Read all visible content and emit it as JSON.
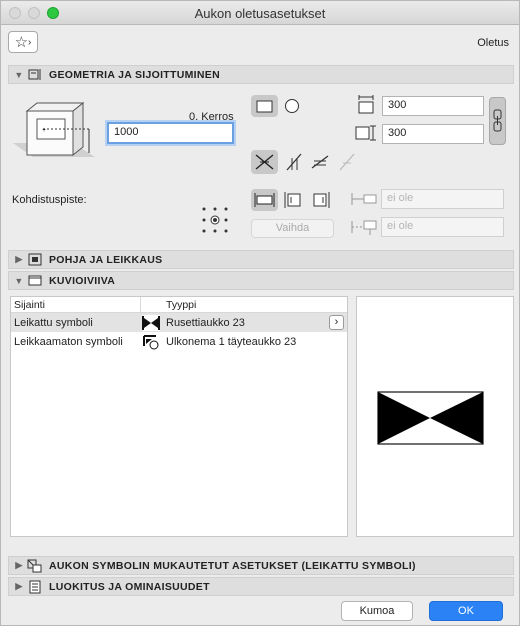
{
  "window": {
    "title": "Aukon oletusasetukset"
  },
  "favorites": {
    "label": "Oletus"
  },
  "sections": {
    "geometry": "GEOMETRIA JA SIJOITTUMINEN",
    "plan": "POHJA JA LEIKKAUS",
    "outline": "KUVIOIVIIVA",
    "custom": "AUKON SYMBOLIN MUKAUTETUT ASETUKSET (LEIKATTU SYMBOLI)",
    "classification": "LUOKITUS JA OMINAISUUDET"
  },
  "geometry": {
    "story_label": "0. Kerros",
    "elevation_value": "1000",
    "width_value": "300",
    "height_value": "300",
    "anchor_label": "Kohdistuspiste:",
    "swap_button": "Vaihda",
    "offset1_placeholder": "ei ole",
    "offset2_placeholder": "ei ole"
  },
  "table": {
    "col_location": "Sijainti",
    "col_type": "Tyyppi",
    "rows": [
      {
        "location": "Leikattu symboli",
        "type": "Rusettiaukko 23"
      },
      {
        "location": "Leikkaamaton symboli",
        "type": "Ulkonema 1 täyteaukko 23"
      }
    ]
  },
  "footer": {
    "cancel": "Kumoa",
    "ok": "OK"
  }
}
